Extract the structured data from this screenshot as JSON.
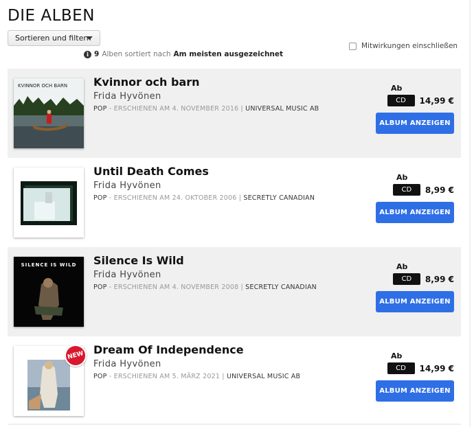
{
  "page": {
    "title": "DIE ALBEN"
  },
  "controls": {
    "sort_label": "Sortieren und filtern",
    "info_count": "9",
    "info_text": "Alben sortiert nach",
    "info_sort": "Am meisten ausgezeichnet",
    "contrib_label": "Mitwirkungen einschließen"
  },
  "albums": [
    {
      "title": "Kvinnor och barn",
      "artist": "Frida Hyvönen",
      "genre": "POP",
      "released": "- ERSCHIENEN AM 4. NOVEMBER 2016 |",
      "label": "UNIVERSAL MUSIC AB",
      "from": "Ab",
      "format": "CD",
      "price": "14,99 €",
      "button": "ALBUM ANZEIGEN",
      "cover_text": "KVINNOR OCH BARN"
    },
    {
      "title": "Until Death Comes",
      "artist": "Frida Hyvönen",
      "genre": "POP",
      "released": "- ERSCHIENEN AM 24. OKTOBER 2006 |",
      "label": "SECRETLY CANADIAN",
      "from": "Ab",
      "format": "CD",
      "price": "8,99 €",
      "button": "ALBUM ANZEIGEN"
    },
    {
      "title": "Silence Is Wild",
      "artist": "Frida Hyvönen",
      "genre": "POP",
      "released": "- ERSCHIENEN AM 4. NOVEMBER 2008 |",
      "label": "SECRETLY CANADIAN",
      "from": "Ab",
      "format": "CD",
      "price": "8,99 €",
      "button": "ALBUM ANZEIGEN",
      "cover_text": "SILENCE IS WILD"
    },
    {
      "title": "Dream Of Independence",
      "artist": "Frida Hyvönen",
      "genre": "POP",
      "released": "- ERSCHIENEN AM 5. MÄRZ 2021 |",
      "label": "UNIVERSAL MUSIC AB",
      "from": "Ab",
      "format": "CD",
      "price": "14,99 €",
      "button": "ALBUM ANZEIGEN",
      "badge": "NEW"
    }
  ],
  "icons": {
    "info": "info-icon",
    "caret": "caret-down-icon"
  },
  "colors": {
    "accent": "#2f6fe6",
    "row_shade": "#f0f0f0",
    "badge": "#d9182e"
  }
}
